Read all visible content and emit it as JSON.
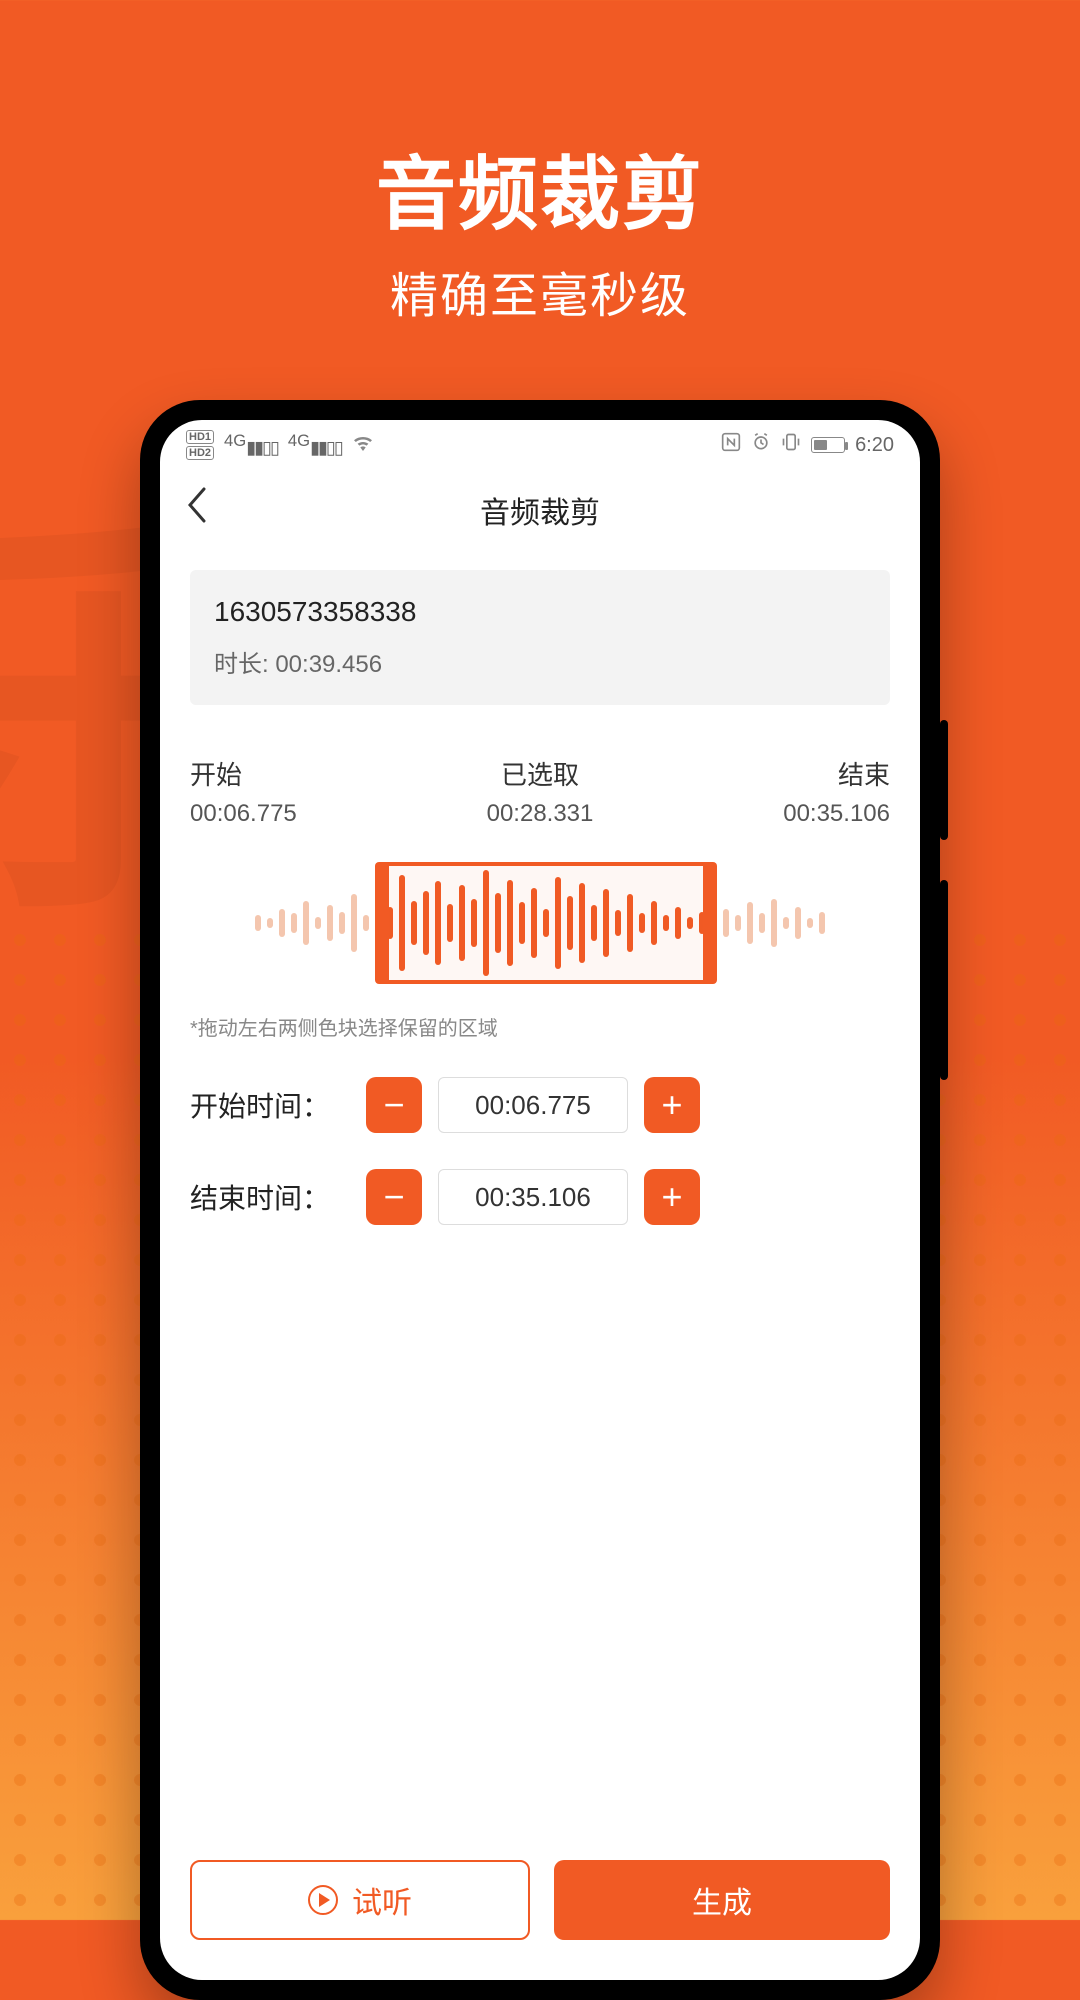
{
  "hero": {
    "title": "音频裁剪",
    "subtitle": "精确至毫秒级"
  },
  "statusbar": {
    "hd1": "HD1",
    "hd2": "HD2",
    "net_tag": "4G",
    "time": "6:20"
  },
  "navbar": {
    "title": "音频裁剪"
  },
  "file": {
    "name": "1630573358338",
    "duration_label": "时长: 00:39.456"
  },
  "marks": {
    "start_label": "开始",
    "start_value": "00:06.775",
    "selected_label": "已选取",
    "selected_value": "00:28.331",
    "end_label": "结束",
    "end_value": "00:35.106"
  },
  "waveform": {
    "bars": [
      10,
      6,
      18,
      12,
      28,
      8,
      22,
      14,
      36,
      10,
      46,
      20,
      60,
      28,
      40,
      52,
      24,
      48,
      30,
      66,
      38,
      54,
      26,
      44,
      18,
      58,
      34,
      50,
      22,
      42,
      16,
      36,
      12,
      28,
      10,
      20,
      8,
      14,
      6,
      18,
      10,
      26,
      12,
      30,
      8,
      20,
      6,
      14
    ],
    "sel_start_index": 11,
    "sel_end_index": 37
  },
  "hint": "*拖动左右两侧色块选择保留的区域",
  "time_controls": {
    "start_label": "开始时间：",
    "start_value": "00:06.775",
    "end_label": "结束时间：",
    "end_value": "00:35.106",
    "minus": "−",
    "plus": "+"
  },
  "footer": {
    "preview": "试听",
    "generate": "生成"
  }
}
